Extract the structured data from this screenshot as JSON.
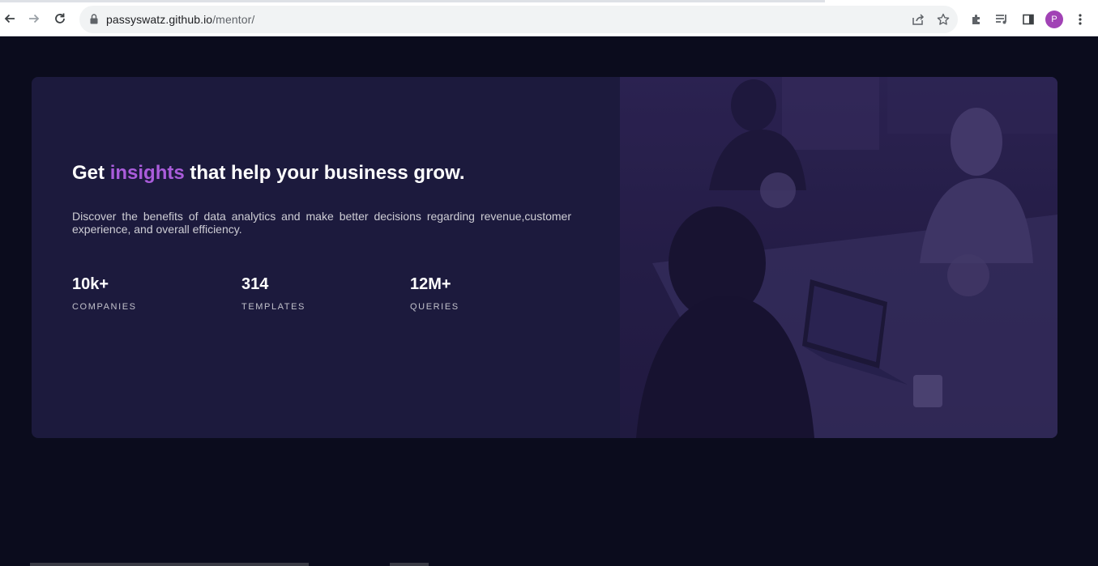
{
  "browser": {
    "url_domain": "passyswatz.github.io",
    "url_path": "/mentor/",
    "profile_initial": "P",
    "icons": [
      "back-icon",
      "forward-icon",
      "reload-icon",
      "lock-icon",
      "share-icon",
      "bookmark-star-icon",
      "extensions-icon",
      "media-icon",
      "side-panel-icon",
      "menu-icon"
    ]
  },
  "hero": {
    "headline_before": "Get ",
    "headline_accent": "insights",
    "headline_after": " that help your business grow.",
    "description": "Discover the benefits of data analytics and make better decisions regarding revenue,customer experience, and overall efficiency.",
    "accent_color": "#aa5cdb",
    "stats": [
      {
        "value": "10k+",
        "label": "COMPANIES"
      },
      {
        "value": "314",
        "label": "TEMPLATES"
      },
      {
        "value": "12M+",
        "label": "QUERIES"
      }
    ]
  },
  "colors": {
    "page_background": "#0b0c1d",
    "card_background": "#1c1a3d",
    "image_overlay": "#2b2350"
  }
}
